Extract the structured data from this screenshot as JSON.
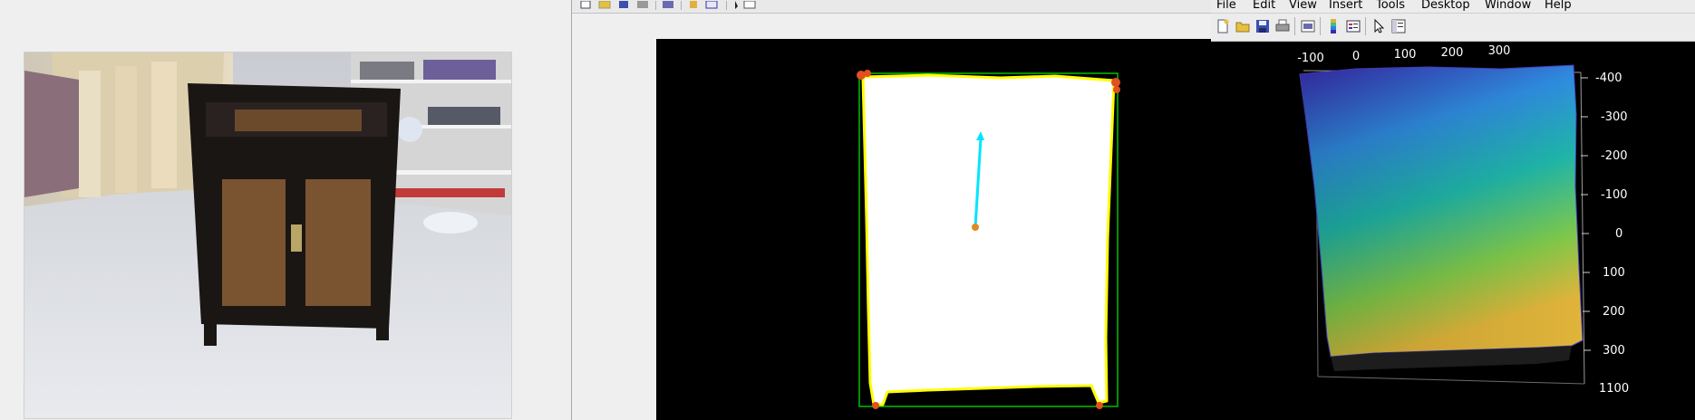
{
  "menubar": {
    "items": [
      "File",
      "Edit",
      "View",
      "Insert",
      "Tools",
      "Desktop",
      "Window",
      "Help"
    ]
  },
  "toolbar_icons": [
    "new-figure-icon",
    "open-file-icon",
    "save-figure-icon",
    "print-figure-icon",
    "print-preview-icon",
    "insert-colorbar-icon",
    "insert-legend-icon",
    "edit-plot-icon",
    "property-inspector-icon"
  ],
  "plot3d": {
    "x_ticks": [
      "-100",
      "0",
      "100",
      "200",
      "300"
    ],
    "y_ticks": [
      "-400",
      "-300",
      "-200",
      "-100",
      "0",
      "100",
      "200",
      "300"
    ],
    "z_tick": "1100",
    "colormap": [
      "#3b2bb5",
      "#2f8ce0",
      "#1fb6a8",
      "#7fc94a",
      "#e0b43a"
    ]
  },
  "mask_view": {
    "mask_color": "#ffffff",
    "contour_color": "#ffff00",
    "bbox_color": "#00c000",
    "corner_color": "#e05020",
    "normal_color": "#00e5ff"
  }
}
